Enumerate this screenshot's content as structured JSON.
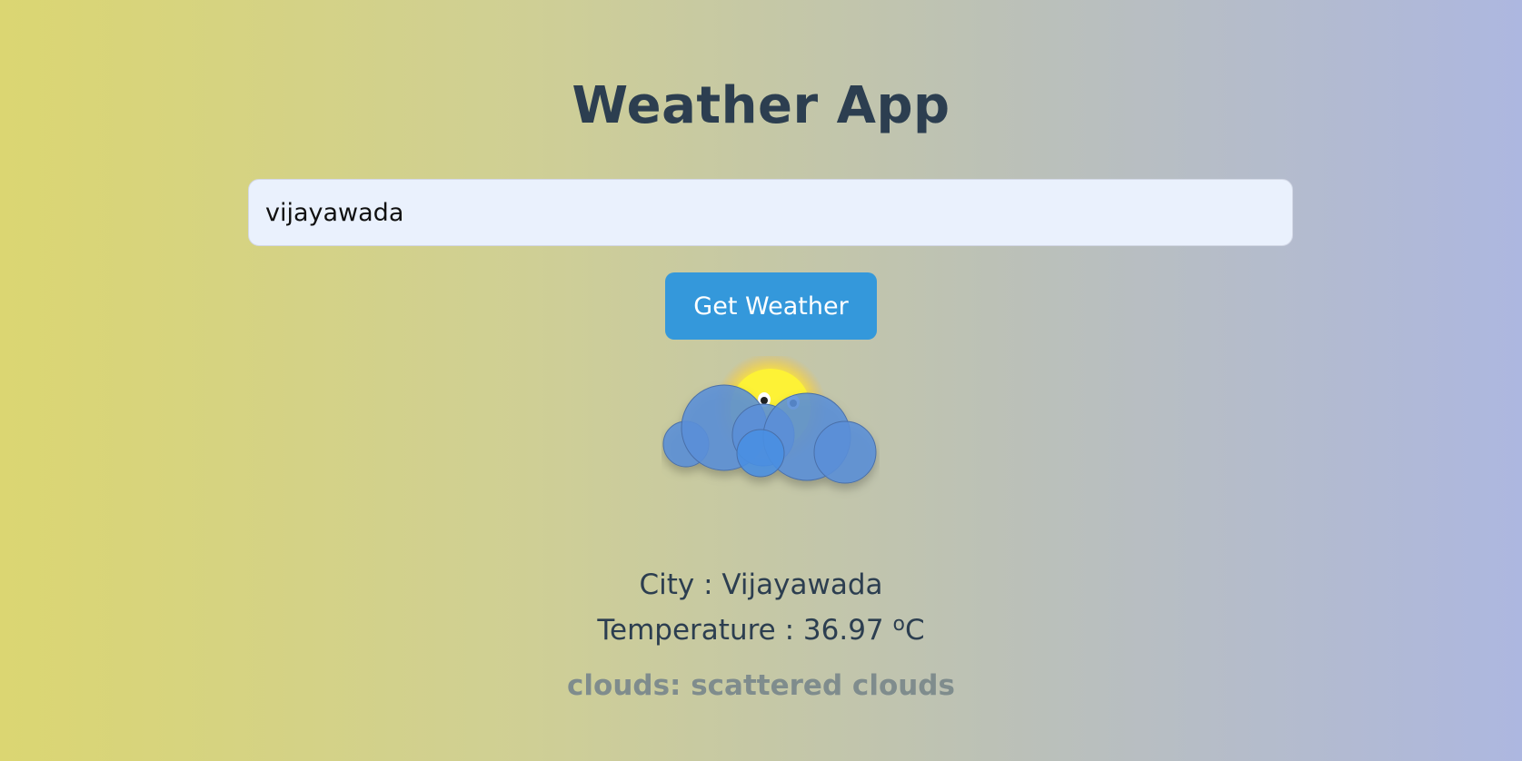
{
  "app": {
    "title": "Weather App"
  },
  "search": {
    "value": "vijayawada",
    "button_label": "Get Weather"
  },
  "weather": {
    "icon": "sun-behind-clouds-icon",
    "city_label": "City : ",
    "city": "Vijayawada",
    "temperature_label": "Temperature : ",
    "temperature": "36.97",
    "temperature_unit_degree": "o",
    "temperature_unit": "C",
    "description": "clouds: scattered clouds"
  },
  "colors": {
    "accent": "#3498db",
    "title_text": "#2c3e50",
    "description_text": "#7f8c8d",
    "input_background": "#eaf1fd"
  }
}
